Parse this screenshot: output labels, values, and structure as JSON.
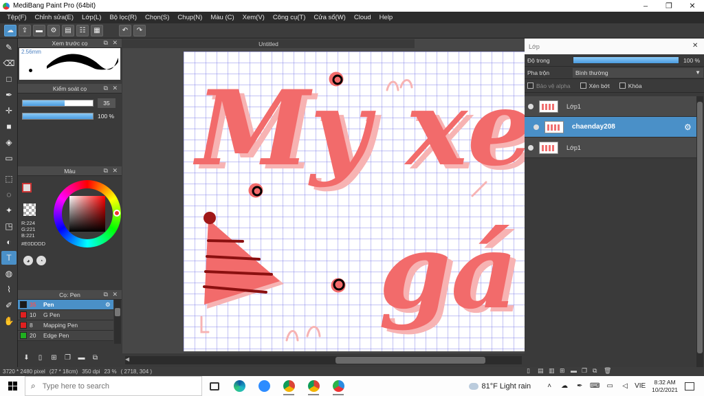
{
  "window": {
    "title": "MediBang Paint Pro (64bit)",
    "minimize": "–",
    "maximize": "❐",
    "close": "✕"
  },
  "menu": [
    "Tệp(F)",
    "Chỉnh sửa(E)",
    "Lớp(L)",
    "Bộ lọc(R)",
    "Chọn(S)",
    "Chụp(N)",
    "Màu (C)",
    "Xem(V)",
    "Công cụ(T)",
    "Cửa sổ(W)",
    "Cloud",
    "Help"
  ],
  "toolbar": {
    "cloud_icon": "☁",
    "share_icon": "⇪",
    "comment_icon": "▬",
    "settings_icon": "⚙",
    "doc_icon": "▤",
    "list_icon": "☷",
    "grid_icon": "▦",
    "undo_icon": "↶",
    "redo_icon": "↷"
  },
  "tools": [
    "✎",
    "⌫",
    "□",
    "✒",
    "✛",
    "■",
    "◈",
    "▭",
    "⬚",
    "◌",
    "✦",
    "◳",
    "◐",
    "T",
    "◍",
    "⌇",
    "✐",
    "✋"
  ],
  "brush_preview": {
    "title": "Xem trước cọ",
    "size_label": "2.56mm"
  },
  "brush_control": {
    "title": "Kiểm soát cọ",
    "size_value": "35",
    "size_fraction": 0.6,
    "opacity_value": "100 %",
    "opacity_fraction": 1.0
  },
  "color": {
    "title": "Màu",
    "r": "R:224",
    "g": "G:221",
    "b": "B:221",
    "hex": "#E0DDDD"
  },
  "brush_list": {
    "title": "Cọ: Pen",
    "items": [
      {
        "size": "35",
        "name": "Pen",
        "color": "#1a1a1a",
        "selected": true
      },
      {
        "size": "10",
        "name": "G Pen",
        "color": "#e02020"
      },
      {
        "size": "8",
        "name": "Mapping Pen",
        "color": "#e02020"
      },
      {
        "size": "20",
        "name": "Edge Pen",
        "color": "#20b020"
      }
    ]
  },
  "canvas": {
    "tab_title": "Untitled",
    "text_line1": "My xein",
    "text_line2": "gá"
  },
  "layers": {
    "title": "Lớp",
    "opacity_label": "Độ trong",
    "opacity_value": "100 %",
    "opacity_fraction": 1.0,
    "blend_label": "Pha trộn",
    "blend_value": "Bình thường",
    "protect_alpha": "Bảo vệ alpha",
    "clipping": "Xén bớt",
    "lock": "Khóa",
    "items": [
      {
        "name": "Lớp1",
        "selected": false
      },
      {
        "name": "chaenday208",
        "selected": true
      },
      {
        "name": "Lớp1",
        "selected": false
      }
    ]
  },
  "status": {
    "size": "3720 * 2480 pixel",
    "dims": "(27 * 18cm)",
    "dpi": "350 dpi",
    "zoom": "23 %",
    "coords": "( 2718, 304 )"
  },
  "taskbar": {
    "search_placeholder": "Type here to search",
    "weather": "81°F  Light rain",
    "lang": "VIE",
    "time": "8:32 AM",
    "date": "10/2/2021"
  },
  "colors": {
    "accent": "#4a90c8",
    "lettering": "#f26b6b",
    "lettering_shadow": "#f7b3b3",
    "hat_stripe": "#8a1010"
  }
}
